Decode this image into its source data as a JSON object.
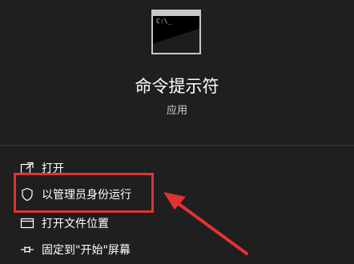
{
  "app": {
    "title": "命令提示符",
    "subtitle": "应用",
    "icon_prompt": "C:\\_",
    "icon": "cmd-app-icon"
  },
  "menu": [
    {
      "label": "打开",
      "icon": "open-icon"
    },
    {
      "label": "以管理员身份运行",
      "icon": "admin-shield-icon"
    },
    {
      "label": "打开文件位置",
      "icon": "file-location-icon"
    },
    {
      "label": "固定到\"开始\"屏幕",
      "icon": "pin-icon"
    }
  ],
  "annotation": {
    "highlight_color": "#e03333",
    "arrow_color": "#e03333"
  },
  "colors": {
    "background": "#1f1f1f",
    "text": "#ffffff",
    "subtext": "#cfcfcf",
    "divider": "#3d3d3d"
  }
}
